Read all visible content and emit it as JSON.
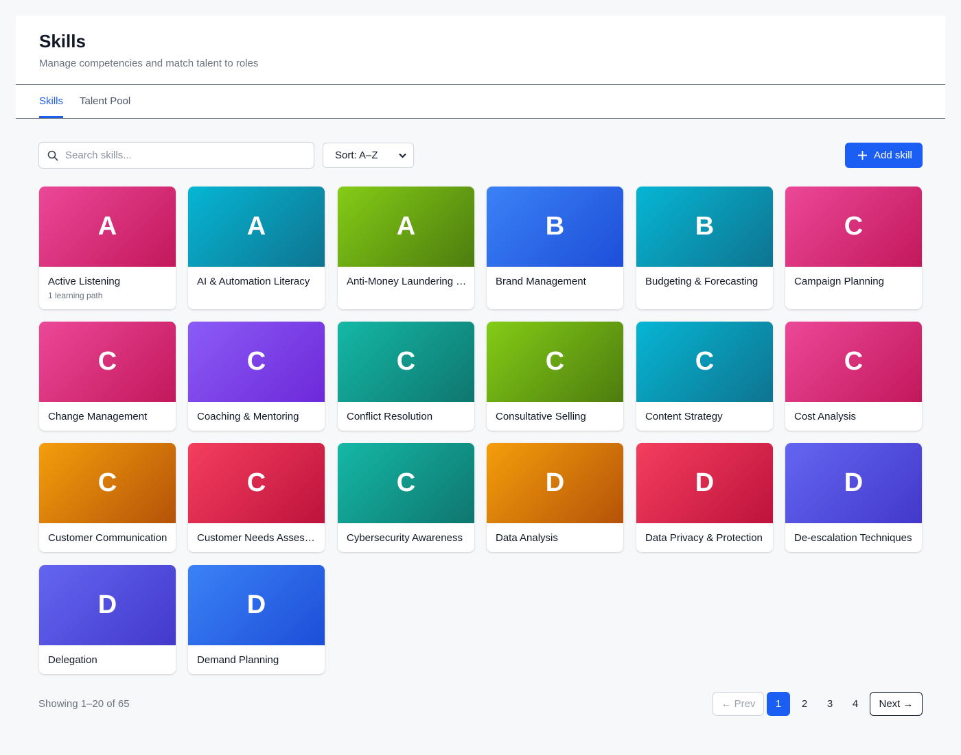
{
  "header": {
    "title": "Skills",
    "subtitle": "Manage competencies and match talent to roles"
  },
  "tabs": [
    {
      "label": "Skills",
      "active": true
    },
    {
      "label": "Talent Pool",
      "active": false
    }
  ],
  "toolbar": {
    "search_placeholder": "Search skills...",
    "search_value": "",
    "sort_label": "Sort: A–Z",
    "add_label": "Add skill"
  },
  "skills": [
    {
      "letter": "A",
      "name": "Active Listening",
      "meta": "1 learning path",
      "color": "pink"
    },
    {
      "letter": "A",
      "name": "AI & Automation Literacy",
      "meta": "",
      "color": "cyan"
    },
    {
      "letter": "A",
      "name": "Anti-Money Laundering (AML)",
      "meta": "",
      "color": "lime"
    },
    {
      "letter": "B",
      "name": "Brand Management",
      "meta": "",
      "color": "blue"
    },
    {
      "letter": "B",
      "name": "Budgeting & Forecasting",
      "meta": "",
      "color": "cyan"
    },
    {
      "letter": "C",
      "name": "Campaign Planning",
      "meta": "",
      "color": "pink"
    },
    {
      "letter": "C",
      "name": "Change Management",
      "meta": "",
      "color": "pink"
    },
    {
      "letter": "C",
      "name": "Coaching & Mentoring",
      "meta": "",
      "color": "violet"
    },
    {
      "letter": "C",
      "name": "Conflict Resolution",
      "meta": "",
      "color": "teal"
    },
    {
      "letter": "C",
      "name": "Consultative Selling",
      "meta": "",
      "color": "lime"
    },
    {
      "letter": "C",
      "name": "Content Strategy",
      "meta": "",
      "color": "cyan"
    },
    {
      "letter": "C",
      "name": "Cost Analysis",
      "meta": "",
      "color": "pink"
    },
    {
      "letter": "C",
      "name": "Customer Communication",
      "meta": "",
      "color": "amber"
    },
    {
      "letter": "C",
      "name": "Customer Needs Assessment",
      "meta": "",
      "color": "rose"
    },
    {
      "letter": "C",
      "name": "Cybersecurity Awareness",
      "meta": "",
      "color": "teal"
    },
    {
      "letter": "D",
      "name": "Data Analysis",
      "meta": "",
      "color": "amber"
    },
    {
      "letter": "D",
      "name": "Data Privacy & Protection",
      "meta": "",
      "color": "rose"
    },
    {
      "letter": "D",
      "name": "De-escalation Techniques",
      "meta": "",
      "color": "indigo"
    },
    {
      "letter": "D",
      "name": "Delegation",
      "meta": "",
      "color": "indigo"
    },
    {
      "letter": "D",
      "name": "Demand Planning",
      "meta": "",
      "color": "blue"
    }
  ],
  "footer": {
    "showing": "Showing 1–20 of 65",
    "prev_label": "← Prev",
    "next_label": "Next →",
    "pages": [
      "1",
      "2",
      "3",
      "4"
    ],
    "current_page": "1"
  },
  "colors": {
    "accent": "#1a5ef3",
    "pink": "#ec4899",
    "cyan": "#06b6d4",
    "lime": "#84cc16",
    "blue": "#3b82f6",
    "violet": "#8b5cf6",
    "teal": "#14b8a6",
    "amber": "#f59e0b",
    "rose": "#f43f5e",
    "indigo": "#6366f1"
  }
}
